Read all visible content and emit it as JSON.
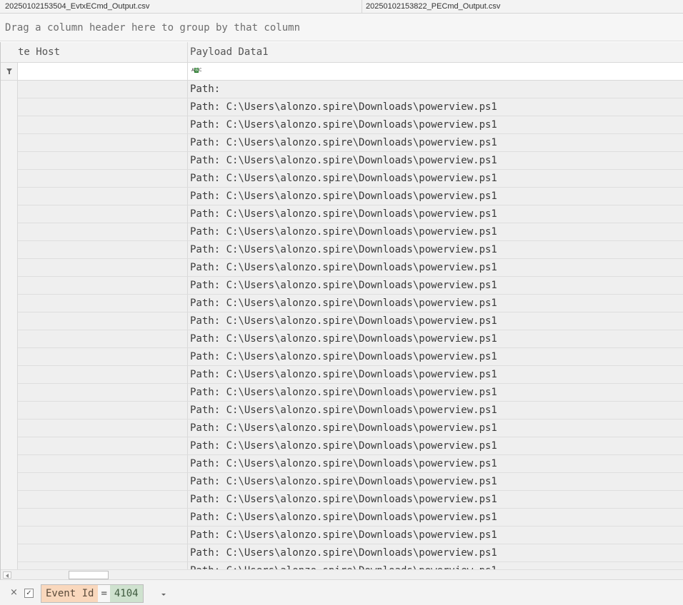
{
  "tabs": [
    {
      "label": "20250102153504_EvtxECmd_Output.csv"
    },
    {
      "label": "20250102153822_PECmd_Output.csv"
    }
  ],
  "group_panel": {
    "text": "Drag a column header here to group by that column"
  },
  "columns": {
    "host": "te Host",
    "payload": "Payload Data1"
  },
  "filter_row": {
    "abc_prefix": "A",
    "abc_mid": "B",
    "abc_suffix": "C"
  },
  "rows": [
    {
      "payload": "Path:"
    },
    {
      "payload": "Path: C:\\Users\\alonzo.spire\\Downloads\\powerview.ps1"
    },
    {
      "payload": "Path: C:\\Users\\alonzo.spire\\Downloads\\powerview.ps1"
    },
    {
      "payload": "Path: C:\\Users\\alonzo.spire\\Downloads\\powerview.ps1"
    },
    {
      "payload": "Path: C:\\Users\\alonzo.spire\\Downloads\\powerview.ps1"
    },
    {
      "payload": "Path: C:\\Users\\alonzo.spire\\Downloads\\powerview.ps1"
    },
    {
      "payload": "Path: C:\\Users\\alonzo.spire\\Downloads\\powerview.ps1"
    },
    {
      "payload": "Path: C:\\Users\\alonzo.spire\\Downloads\\powerview.ps1"
    },
    {
      "payload": "Path: C:\\Users\\alonzo.spire\\Downloads\\powerview.ps1"
    },
    {
      "payload": "Path: C:\\Users\\alonzo.spire\\Downloads\\powerview.ps1"
    },
    {
      "payload": "Path: C:\\Users\\alonzo.spire\\Downloads\\powerview.ps1"
    },
    {
      "payload": "Path: C:\\Users\\alonzo.spire\\Downloads\\powerview.ps1"
    },
    {
      "payload": "Path: C:\\Users\\alonzo.spire\\Downloads\\powerview.ps1"
    },
    {
      "payload": "Path: C:\\Users\\alonzo.spire\\Downloads\\powerview.ps1"
    },
    {
      "payload": "Path: C:\\Users\\alonzo.spire\\Downloads\\powerview.ps1"
    },
    {
      "payload": "Path: C:\\Users\\alonzo.spire\\Downloads\\powerview.ps1"
    },
    {
      "payload": "Path: C:\\Users\\alonzo.spire\\Downloads\\powerview.ps1"
    },
    {
      "payload": "Path: C:\\Users\\alonzo.spire\\Downloads\\powerview.ps1"
    },
    {
      "payload": "Path: C:\\Users\\alonzo.spire\\Downloads\\powerview.ps1"
    },
    {
      "payload": "Path: C:\\Users\\alonzo.spire\\Downloads\\powerview.ps1"
    },
    {
      "payload": "Path: C:\\Users\\alonzo.spire\\Downloads\\powerview.ps1"
    },
    {
      "payload": "Path: C:\\Users\\alonzo.spire\\Downloads\\powerview.ps1"
    },
    {
      "payload": "Path: C:\\Users\\alonzo.spire\\Downloads\\powerview.ps1"
    },
    {
      "payload": "Path: C:\\Users\\alonzo.spire\\Downloads\\powerview.ps1"
    },
    {
      "payload": "Path: C:\\Users\\alonzo.spire\\Downloads\\powerview.ps1"
    },
    {
      "payload": "Path: C:\\Users\\alonzo.spire\\Downloads\\powerview.ps1"
    },
    {
      "payload": "Path: C:\\Users\\alonzo.spire\\Downloads\\powerview.ps1"
    },
    {
      "payload": "Path: C:\\Users\\alonzo.spire\\Downloads\\powerview.ps1"
    }
  ],
  "filter_bar": {
    "close_glyph": "×",
    "check_glyph": "✓",
    "field": "Event Id",
    "operator": "=",
    "value": "4104"
  }
}
